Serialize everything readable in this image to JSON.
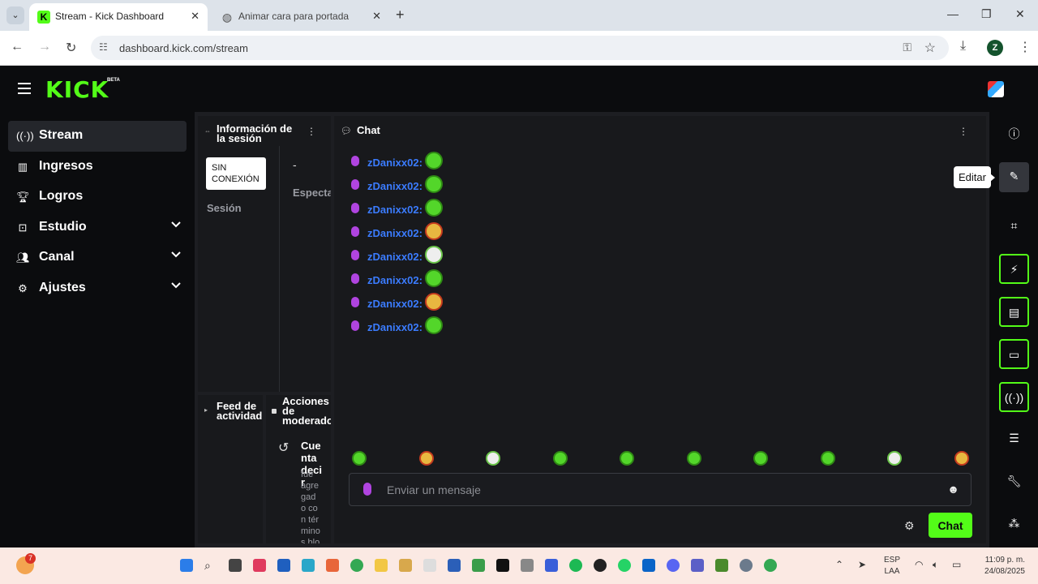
{
  "browser": {
    "tabs": [
      {
        "title": "Stream - Kick Dashboard",
        "active": true
      },
      {
        "title": "Animar cara para portada",
        "active": false
      }
    ],
    "url": "dashboard.kick.com/stream",
    "profile_initial": "Z"
  },
  "app": {
    "logo": "KICK",
    "logo_badge": "BETA"
  },
  "sidebar": {
    "items": [
      {
        "label": "Stream",
        "icon": "stream-icon",
        "active": true
      },
      {
        "label": "Ingresos",
        "icon": "bar-chart-icon"
      },
      {
        "label": "Logros",
        "icon": "trophy-icon"
      },
      {
        "label": "Estudio",
        "icon": "studio-icon",
        "expandable": true
      },
      {
        "label": "Canal",
        "icon": "people-icon",
        "expandable": true
      },
      {
        "label": "Ajustes",
        "icon": "gear-icon",
        "expandable": true
      }
    ]
  },
  "session": {
    "title": "Información de la sesión",
    "status": "SIN CONEXIÓN",
    "session_label": "Sesión",
    "value": "-",
    "viewers_label": "Espectadores"
  },
  "chat": {
    "title": "Chat",
    "messages": [
      {
        "user": "zDanixx02:",
        "emote": "green"
      },
      {
        "user": "zDanixx02:",
        "emote": "green"
      },
      {
        "user": "zDanixx02:",
        "emote": "green"
      },
      {
        "user": "zDanixx02:",
        "emote": "red"
      },
      {
        "user": "zDanixx02:",
        "emote": "white"
      },
      {
        "user": "zDanixx02:",
        "emote": "green"
      },
      {
        "user": "zDanixx02:",
        "emote": "red"
      },
      {
        "user": "zDanixx02:",
        "emote": "green"
      }
    ],
    "emote_bar": [
      "green",
      "red",
      "white",
      "green",
      "green",
      "green",
      "green",
      "green",
      "white",
      "red"
    ],
    "input_placeholder": "Enviar un mensaje",
    "send_label": "Chat"
  },
  "feed": {
    "title": "Feed de actividad"
  },
  "moderation": {
    "title": "Acciones de moderador",
    "action_title": "Cuenta decir",
    "action_body": "fue agregado con términos bloqueados por"
  },
  "rail": {
    "tooltip": "Editar",
    "icons": [
      "info-icon",
      "edit-icon",
      "scan-icon",
      "lightning-icon",
      "notes-icon",
      "chat-bubble-icon",
      "broadcast-icon",
      "layout-icon",
      "wrench-icon",
      "share-icon"
    ]
  },
  "taskbar": {
    "notification_count": "7",
    "lang_top": "ESP",
    "lang_bottom": "LAA",
    "time": "11:09 p. m.",
    "date": "24/08/2025"
  }
}
